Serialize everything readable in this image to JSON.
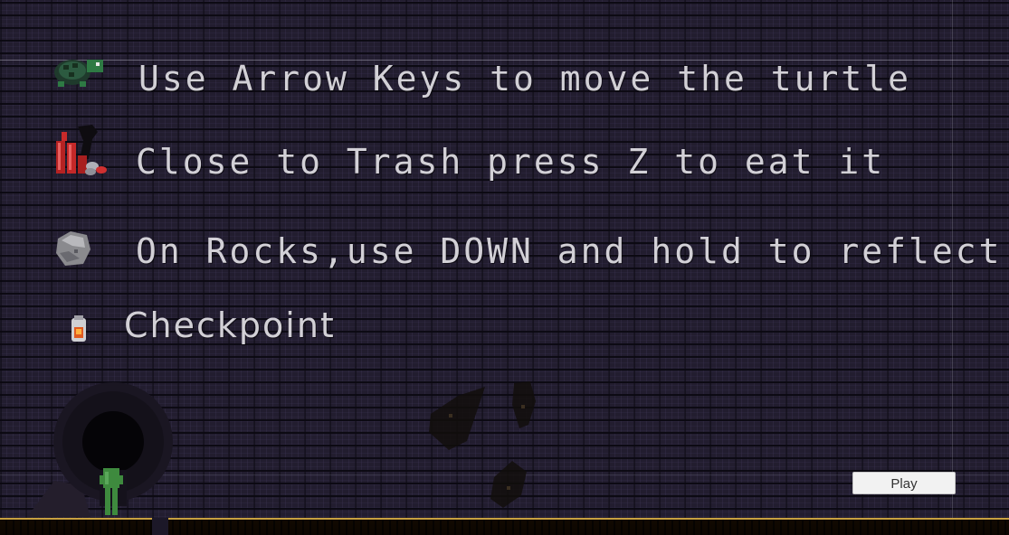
{
  "instructions": [
    {
      "icon": "turtle-icon",
      "text": "Use Arrow Keys to move the turtle"
    },
    {
      "icon": "trash-icon",
      "text": "Close to Trash press Z to eat it"
    },
    {
      "icon": "rock-icon",
      "text": "On Rocks,use DOWN and hold to reflect it"
    },
    {
      "icon": "checkpoint-icon",
      "text": "Checkpoint"
    }
  ],
  "play_button": {
    "label": "Play"
  },
  "colors": {
    "text": "#d2d0d6",
    "brick_bg": "#221d2f",
    "ground": "#b08a34",
    "button_bg": "#f2f2f2"
  }
}
